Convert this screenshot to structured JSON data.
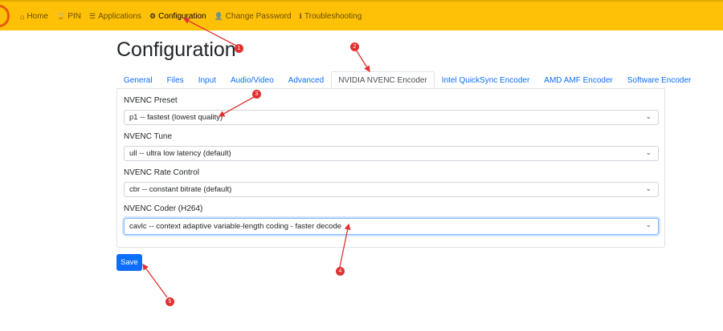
{
  "nav": {
    "items": [
      {
        "label": "Home",
        "icon": "home-icon",
        "glyph": "⌂"
      },
      {
        "label": "PIN",
        "icon": "lock-icon",
        "glyph": "🔒"
      },
      {
        "label": "Applications",
        "icon": "list-icon",
        "glyph": "☰"
      },
      {
        "label": "Configuration",
        "icon": "gear-icon",
        "glyph": "⚙",
        "active": true
      },
      {
        "label": "Change Password",
        "icon": "user-key-icon",
        "glyph": "👤"
      },
      {
        "label": "Troubleshooting",
        "icon": "info-icon",
        "glyph": "ℹ"
      }
    ]
  },
  "page_title": "Configuration",
  "tabs": [
    "General",
    "Files",
    "Input",
    "Audio/Video",
    "Advanced",
    "NVIDIA NVENC Encoder",
    "Intel QuickSync Encoder",
    "AMD AMF Encoder",
    "Software Encoder"
  ],
  "active_tab": "NVIDIA NVENC Encoder",
  "fields": [
    {
      "label": "NVENC Preset",
      "value": "p1 -- fastest (lowest quality)"
    },
    {
      "label": "NVENC Tune",
      "value": "ull -- ultra low latency (default)"
    },
    {
      "label": "NVENC Rate Control",
      "value": "cbr -- constant bitrate (default)"
    },
    {
      "label": "NVENC Coder (H264)",
      "value": "cavlc -- context adaptive variable-length coding - faster decode",
      "focused": true
    }
  ],
  "save_label": "Save",
  "annotations": [
    "1",
    "2",
    "3",
    "4",
    "5"
  ],
  "colors": {
    "navbar": "#ffc107",
    "primary": "#0d6efd",
    "annotation": "#e03131"
  }
}
